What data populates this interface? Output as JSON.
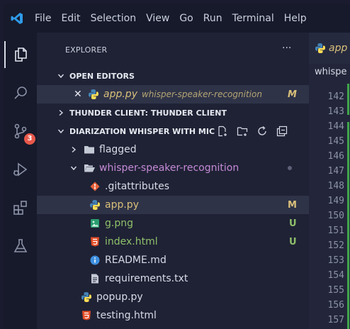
{
  "menubar": {
    "items": [
      "File",
      "Edit",
      "Selection",
      "View",
      "Go",
      "Run",
      "Terminal",
      "Help"
    ]
  },
  "activity": {
    "scm_badge": "3"
  },
  "sidebar": {
    "title": "EXPLORER",
    "more": "···",
    "open_editors": {
      "label": "OPEN EDITORS",
      "items": [
        {
          "name": "app.py",
          "description": "whisper-speaker-recognition",
          "status": "M"
        }
      ]
    },
    "thunder_client": {
      "label": "THUNDER CLIENT: THUNDER CLIENT"
    },
    "workspace": {
      "label": "DIARIZATION WHISPER WITH MIC",
      "folders": [
        {
          "name": "flagged"
        },
        {
          "name": "whisper-speaker-recognition"
        }
      ],
      "files": [
        {
          "name": ".gitattributes",
          "status": ""
        },
        {
          "name": "app.py",
          "status": "M"
        },
        {
          "name": "g.png",
          "status": "U"
        },
        {
          "name": "index.html",
          "status": "U"
        },
        {
          "name": "README.md",
          "status": ""
        },
        {
          "name": "requirements.txt",
          "status": ""
        }
      ],
      "root_files": [
        {
          "name": "popup.py"
        },
        {
          "name": "testing.html"
        }
      ]
    }
  },
  "editor": {
    "tab_label": "app",
    "breadcrumb": "whispe",
    "line_numbers": [
      "142",
      "143",
      "144",
      "145",
      "146",
      "147",
      "148",
      "149",
      "150",
      "151",
      "152",
      "153",
      "154",
      "155",
      "156",
      "157"
    ]
  },
  "colors": {
    "accent_modified": "#d9c07a",
    "accent_untracked": "#8fc06a",
    "badge": "#e8584a"
  }
}
